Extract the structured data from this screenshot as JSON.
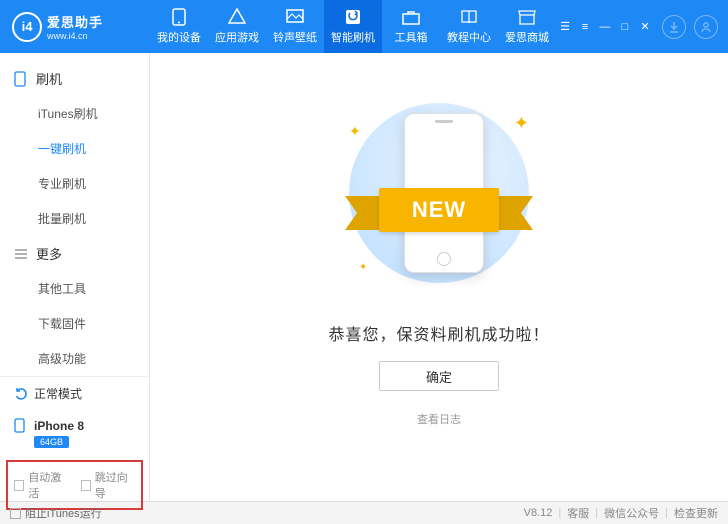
{
  "brand": {
    "name": "爱思助手",
    "url": "www.i4.cn",
    "logo": "i4"
  },
  "nav": [
    {
      "label": "我的设备"
    },
    {
      "label": "应用游戏"
    },
    {
      "label": "铃声壁纸"
    },
    {
      "label": "智能刷机"
    },
    {
      "label": "工具箱"
    },
    {
      "label": "教程中心"
    },
    {
      "label": "爱思商城"
    }
  ],
  "sidebar": {
    "group1": {
      "title": "刷机",
      "items": [
        "iTunes刷机",
        "一键刷机",
        "专业刷机",
        "批量刷机"
      ],
      "activeIndex": 1
    },
    "group2": {
      "title": "更多",
      "items": [
        "其他工具",
        "下载固件",
        "高级功能"
      ]
    },
    "status": "正常模式",
    "device": {
      "name": "iPhone 8",
      "storage": "64GB"
    },
    "checks": {
      "autoActivate": "自动激活",
      "skipGuide": "跳过向导"
    }
  },
  "content": {
    "ribbon": "NEW",
    "message": "恭喜您，保资料刷机成功啦！",
    "confirm": "确定",
    "viewLog": "查看日志"
  },
  "footer": {
    "blockItunes": "阻止iTunes运行",
    "version": "V8.12",
    "support": "客服",
    "wechat": "微信公众号",
    "checkUpdate": "检查更新"
  }
}
